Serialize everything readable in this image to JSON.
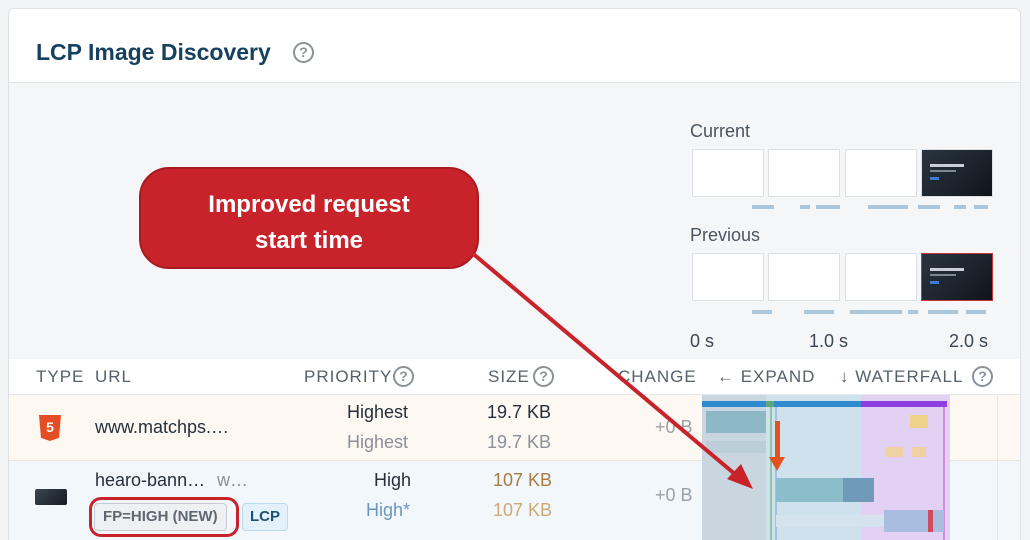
{
  "card": {
    "title": "LCP Image Discovery"
  },
  "filmstrip": {
    "current_label": "Current",
    "previous_label": "Previous",
    "axis": [
      "0 s",
      "1.0 s",
      "2.0 s"
    ]
  },
  "callout": {
    "text": "Improved request\nstart time"
  },
  "columns": {
    "type": "TYPE",
    "url": "URL",
    "priority": "PRIORITY",
    "size": "SIZE",
    "change": "CHANGE",
    "expand": "← EXPAND",
    "waterfall": "↓ WATERFALL"
  },
  "rows": [
    {
      "type_icon": "html5-icon",
      "url": "www.matchps.…",
      "priority_current": "Highest",
      "priority_previous": "Highest",
      "size_current": "19.7 KB",
      "size_previous": "19.7 KB",
      "change": "+0 B"
    },
    {
      "type_icon": "image-icon",
      "url": "hearo-bann…",
      "url_suffix": "w…",
      "badge_fp": "FP=HIGH (NEW)",
      "badge_lcp": "LCP",
      "priority_current": "High",
      "priority_previous": "High*",
      "size_current": "107 KB",
      "size_previous": "107 KB",
      "change": "+0 B"
    }
  ],
  "colors": {
    "title": "#17415e",
    "callout": "#c8232a",
    "html5": "#e44d26",
    "waterfall_purple": "#8f3fe0",
    "waterfall_blue": "#2f8ad0",
    "arrow": "#e0531f"
  }
}
